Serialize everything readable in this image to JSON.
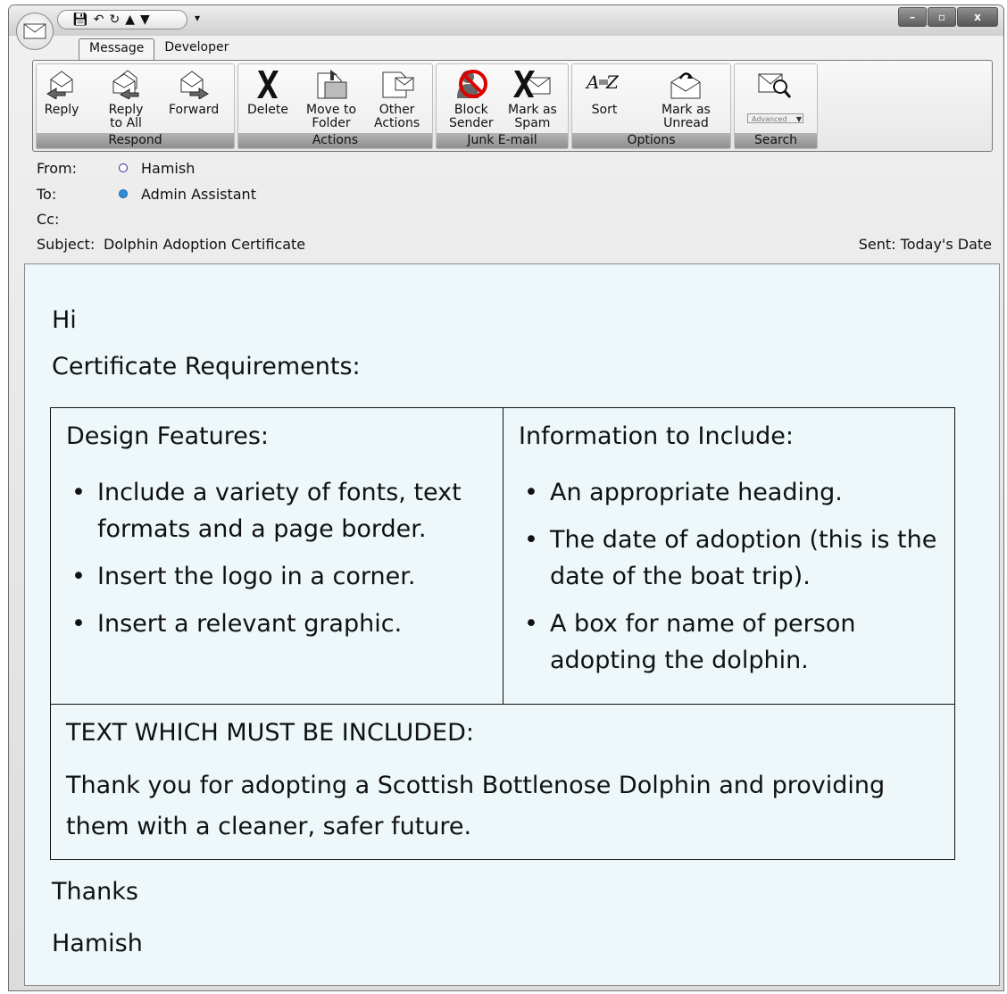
{
  "ribbon": {
    "tabs": [
      "Message",
      "Developer"
    ],
    "groups": [
      {
        "label": "Respond",
        "buttons": [
          "Reply",
          "Reply\nto All",
          "Forward"
        ]
      },
      {
        "label": "Actions",
        "buttons": [
          "Delete",
          "Move to\nFolder",
          "Other\nActions"
        ]
      },
      {
        "label": "Junk E-mail",
        "buttons": [
          "Block\nSender",
          "Mark as\nSpam"
        ]
      },
      {
        "label": "Options",
        "buttons": [
          "Sort",
          "Mark as\nUnread"
        ]
      },
      {
        "label": "Search",
        "advanced": "Advanced"
      }
    ]
  },
  "header": {
    "from_label": "From:",
    "from_value": "Hamish",
    "to_label": "To:",
    "to_value": "Admin Assistant",
    "cc_label": "Cc:",
    "subject_label": "Subject:",
    "subject_value": "Dolphin Adoption Certificate",
    "sent_label": "Sent:",
    "sent_value": "Today's Date"
  },
  "body": {
    "greeting": "Hi",
    "intro": "Certificate Requirements:",
    "design_title": "Design Features:",
    "design_items": [
      "Include a variety of fonts, text formats and a page border.",
      "Insert the logo in a corner.",
      "Insert a relevant graphic."
    ],
    "info_title": "Information to Include:",
    "info_items": [
      "An appropriate heading.",
      "The date of adoption (this is the date of the boat trip).",
      "A box for name of person adopting the dolphin."
    ],
    "text_title": "TEXT WHICH MUST BE INCLUDED:",
    "text_body": "Thank you for adopting a Scottish Bottlenose Dolphin and providing them with a cleaner, safer future.",
    "signoff": "Thanks",
    "signature": "Hamish"
  },
  "colors": {
    "body_background": "#eef8fa",
    "to_dot": "#2f8fd8",
    "from_dot": "#2a2aa0"
  }
}
